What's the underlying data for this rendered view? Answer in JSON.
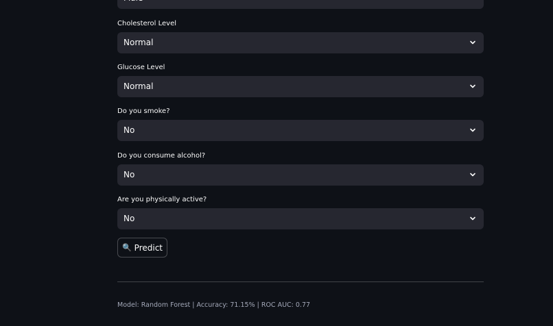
{
  "form": {
    "gender": {
      "label": "",
      "value": "Male"
    },
    "cholesterol": {
      "label": "Cholesterol Level",
      "value": "Normal"
    },
    "glucose": {
      "label": "Glucose Level",
      "value": "Normal"
    },
    "smoke": {
      "label": "Do you smoke?",
      "value": "No"
    },
    "alcohol": {
      "label": "Do you consume alcohol?",
      "value": "No"
    },
    "active": {
      "label": "Are you physically active?",
      "value": "No"
    }
  },
  "predict_button": {
    "icon": "🔍",
    "label": "Predict"
  },
  "footer": {
    "text": "Model: Random Forest | Accuracy: 71.15% | ROC AUC: 0.77"
  },
  "colors": {
    "background": "#0e1117",
    "select_background": "#262730",
    "text": "#fafafa",
    "caption": "#a3a8b8"
  }
}
